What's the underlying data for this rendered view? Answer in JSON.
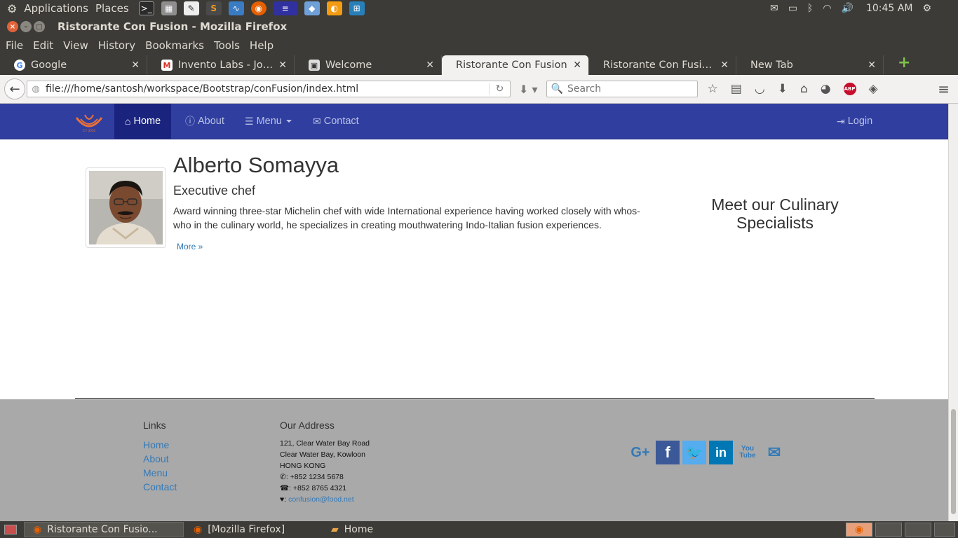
{
  "desktop": {
    "menu_applications": "Applications",
    "menu_places": "Places",
    "clock": "10:45 AM"
  },
  "window": {
    "title": "Ristorante Con Fusion - Mozilla Firefox"
  },
  "firefox_menu": [
    "File",
    "Edit",
    "View",
    "History",
    "Bookmarks",
    "Tools",
    "Help"
  ],
  "tabs": [
    {
      "title": "Google",
      "icon": "google-icon"
    },
    {
      "title": "Invento Labs - Job O...",
      "icon": "gmail-icon"
    },
    {
      "title": "Welcome",
      "icon": "page-icon"
    },
    {
      "title": "Ristorante Con Fusion",
      "icon": "none",
      "active": true
    },
    {
      "title": "Ristorante Con Fusion: ...",
      "icon": "none"
    },
    {
      "title": "New Tab",
      "icon": "none"
    }
  ],
  "address_bar": {
    "url": "file:///home/santosh/workspace/Bootstrap/conFusion/index.html"
  },
  "search_bar": {
    "placeholder": "Search"
  },
  "site_nav": {
    "home": "Home",
    "about": "About",
    "menu": "Menu",
    "contact": "Contact",
    "login": "Login"
  },
  "chef": {
    "name": "Alberto Somayya",
    "role": "Executive chef",
    "description": "Award winning three-star Michelin chef with wide International experience having worked closely with whos-who in the culinary world, he specializes in creating mouthwatering Indo-Italian fusion experiences.",
    "more": "More »"
  },
  "aside": {
    "title": "Meet our Culinary Specialists"
  },
  "footer": {
    "links_heading": "Links",
    "links": [
      "Home",
      "About",
      "Menu",
      "Contact"
    ],
    "address_heading": "Our Address",
    "address_lines": [
      "121, Clear Water Bay Road",
      "Clear Water Bay, Kowloon",
      "HONG KONG"
    ],
    "phone": ": +852 1234 5678",
    "fax": ": +852 8765 4321",
    "email_prefix": ": ",
    "email": "confusion@food.net"
  },
  "taskbar": {
    "items": [
      "Ristorante Con Fusio...",
      "[Mozilla Firefox]",
      "Home"
    ]
  },
  "colors": {
    "site_nav_bg": "#303f9f",
    "site_nav_active": "#1a237e",
    "footer_bg": "#a9a9a9",
    "link": "#337ab7",
    "facebook": "#3b5998",
    "twitter": "#55acee",
    "linkedin": "#0077b5"
  }
}
